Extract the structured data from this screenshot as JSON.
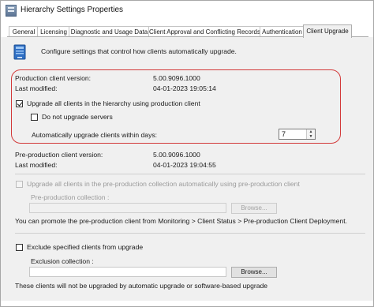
{
  "window": {
    "title": "Hierarchy Settings Properties"
  },
  "tabs": [
    {
      "label": "General"
    },
    {
      "label": "Licensing"
    },
    {
      "label": "Diagnostic and Usage Data"
    },
    {
      "label": "Client Approval and Conflicting Records"
    },
    {
      "label": "Authentication"
    },
    {
      "label": "Client Upgrade",
      "active": true
    }
  ],
  "header": {
    "icon": "computer-upgrade-icon",
    "description": "Configure settings that control how clients automatically upgrade."
  },
  "production": {
    "version_label": "Production client version:",
    "version_value": "5.00.9096.1000",
    "modified_label": "Last modified:",
    "modified_value": "04-01-2023 19:05:14",
    "upgrade_all_label": "Upgrade all clients in the hierarchy using production client",
    "upgrade_all_checked": true,
    "no_servers_label": "Do not upgrade servers",
    "no_servers_checked": false,
    "days_label": "Automatically upgrade clients within days:",
    "days_value": "7"
  },
  "preproduction": {
    "version_label": "Pre-production client version:",
    "version_value": "5.00.9096.1000",
    "modified_label": "Last modified:",
    "modified_value": "04-01-2023 19:04:55",
    "upgrade_label": "Upgrade all clients in the pre-production collection automatically using pre-production client",
    "collection_label": "Pre-production collection :",
    "browse_label": "Browse...",
    "note": "You can promote the pre-production client from Monitoring > Client Status > Pre-production Client Deployment."
  },
  "exclude": {
    "checkbox_label": "Exclude specified clients from upgrade",
    "collection_label": "Exclusion collection :",
    "browse_label": "Browse...",
    "note": "These clients will not be upgraded by automatic upgrade or software-based upgrade"
  },
  "annotation": {
    "highlight_color": "#d33a3a"
  }
}
